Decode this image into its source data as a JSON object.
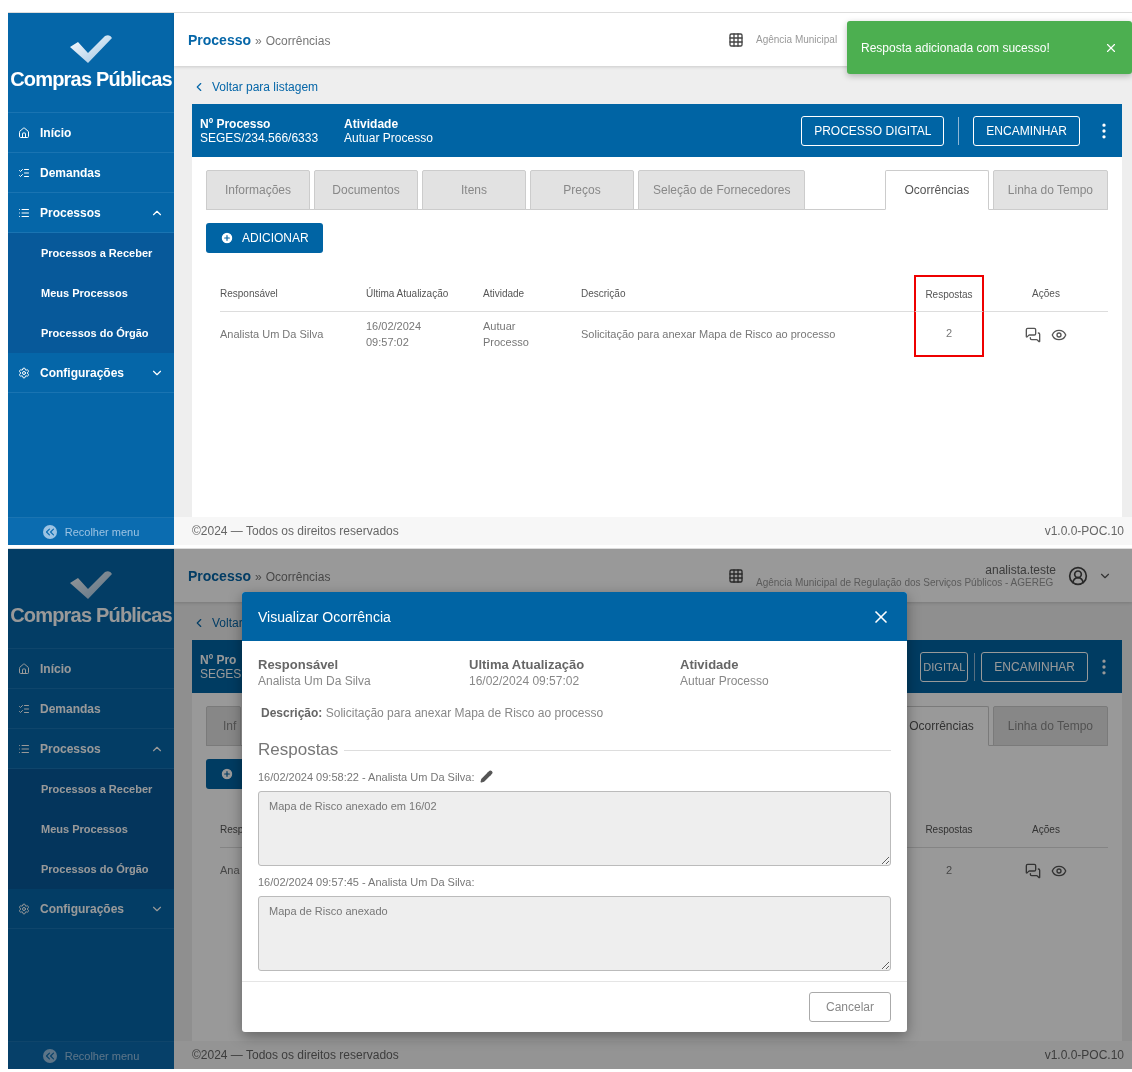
{
  "panels": [
    {
      "sidebar": {
        "logo_text": "Compras Públicas",
        "items": [
          {
            "label": "Início"
          },
          {
            "label": "Demandas"
          },
          {
            "label": "Processos",
            "expanded": true,
            "children": [
              {
                "label": "Processos a Receber"
              },
              {
                "label": "Meus Processos"
              },
              {
                "label": "Processos do Órgão"
              }
            ]
          },
          {
            "label": "Configurações",
            "expanded": false
          }
        ],
        "collapse_label": "Recolher menu"
      },
      "header": {
        "breadcrumb_link": "Processo",
        "breadcrumb_separator": "»",
        "breadcrumb_current": "Ocorrências",
        "org": "Agência Municipal"
      },
      "back_link": "Voltar para listagem",
      "process_bar": {
        "fields": [
          {
            "label": "Nº Processo",
            "value": "SEGES/234.566/6333"
          },
          {
            "label": "Atividade",
            "value": "Autuar Processo"
          }
        ],
        "buttons": [
          "PROCESSO DIGITAL",
          "ENCAMINHAR"
        ]
      },
      "tabs": [
        {
          "label": "Informações",
          "selected": false
        },
        {
          "label": "Documentos",
          "selected": false
        },
        {
          "label": "Itens",
          "selected": false
        },
        {
          "label": "Preços",
          "selected": false
        },
        {
          "label": "Seleção de Fornecedores",
          "selected": false
        },
        {
          "label": "Ocorrências",
          "selected": true
        },
        {
          "label": "Linha do Tempo",
          "selected": false
        }
      ],
      "add_button": {
        "label": "ADICIONAR",
        "covered": false
      },
      "table": {
        "columns": [
          {
            "label": "Responsável",
            "highlighted": false
          },
          {
            "label": "Última Atualização",
            "highlighted": false
          },
          {
            "label": "Atividade",
            "highlighted": false
          },
          {
            "label": "Descrição",
            "highlighted": false
          },
          {
            "label": "Respostas",
            "highlighted": true
          },
          {
            "label": "Ações",
            "highlighted": false
          }
        ],
        "rows": [
          {
            "cells": [
              "Analista Um Da Silva",
              "16/02/2024\n09:57:02",
              "Autuar\nProcesso",
              "Solicitação para anexar Mapa de Risco ao processo",
              "2",
              null
            ]
          }
        ]
      },
      "footer": {
        "copyright": "©2024 — Todos os direitos reservados",
        "version": "v1.0.0-POC.10"
      },
      "toast": {
        "text": "Resposta adicionada com sucesso!"
      }
    },
    {
      "sidebar": {
        "logo_text": "Compras Públicas",
        "items": [
          {
            "label": "Início"
          },
          {
            "label": "Demandas"
          },
          {
            "label": "Processos",
            "expanded": true,
            "children": [
              {
                "label": "Processos a Receber"
              },
              {
                "label": "Meus Processos"
              },
              {
                "label": "Processos do Órgão"
              }
            ]
          },
          {
            "label": "Configurações",
            "expanded": false
          }
        ],
        "collapse_label": "Recolher menu"
      },
      "header": {
        "breadcrumb_link": "Processo",
        "breadcrumb_separator": "»",
        "breadcrumb_current": "Ocorrências",
        "org": "Agência Municipal de Regulação dos Serviços Públicos - AGEREG",
        "user": "analista.teste"
      },
      "back_link": "Voltar",
      "process_bar": {
        "fields": [
          {
            "label": "Nº Pro",
            "value": "SEGES"
          }
        ],
        "buttons": [
          "DIGITAL",
          "ENCAMINHAR"
        ]
      },
      "tabs": [
        {
          "label": "Inf",
          "selected": false
        },
        {
          "label": "Ocorrências",
          "selected": true
        },
        {
          "label": "Linha do Tempo",
          "selected": false
        }
      ],
      "add_button": {
        "covered": true
      },
      "table": {
        "columns": [
          {
            "label": "Resp",
            "highlighted": false
          },
          null,
          null,
          null,
          {
            "label": "Respostas",
            "highlighted": false
          },
          {
            "label": "Ações",
            "highlighted": false
          }
        ],
        "rows": [
          {
            "cells": [
              "Ana",
              null,
              null,
              null,
              "2",
              null
            ]
          }
        ]
      },
      "footer": {
        "copyright": "©2024 — Todos os direitos reservados",
        "version": "v1.0.0-POC.10"
      },
      "modal": {
        "title": "Visualizar Ocorrência",
        "fields": [
          {
            "label": "Responsável",
            "value": "Analista Um Da Silva"
          },
          {
            "label": "Ultima Atualização",
            "value": "16/02/2024 09:57:02"
          },
          {
            "label": "Atividade",
            "value": "Autuar Processo"
          }
        ],
        "description_label": "Descrição:",
        "description": "Solicitação para anexar Mapa de Risco ao processo",
        "responses_title": "Respostas",
        "responses": [
          {
            "meta": "16/02/2024 09:58:22 - Analista Um Da Silva:",
            "text": "Mapa de Risco anexado em 16/02",
            "editable": true
          },
          {
            "meta": "16/02/2024 09:57:45 - Analista Um Da Silva:",
            "text": "Mapa de Risco anexado",
            "editable": false
          }
        ],
        "cancel_label": "Cancelar"
      }
    }
  ]
}
